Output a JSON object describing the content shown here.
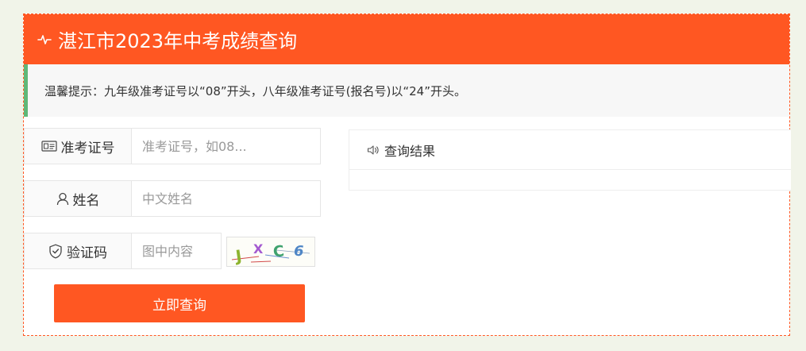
{
  "header": {
    "title": "湛江市2023年中考成绩查询",
    "icon": "pulse-icon"
  },
  "notice": {
    "text": "温馨提示：九年级准考证号以“08”开头，八年级准考证号(报名号)以“24”开头。"
  },
  "form": {
    "exam_id": {
      "label": "准考证号",
      "placeholder": "准考证号，如08...",
      "value": "",
      "icon": "id-card-icon"
    },
    "name": {
      "label": "姓名",
      "placeholder": "中文姓名",
      "value": "",
      "icon": "user-icon"
    },
    "captcha": {
      "label": "验证码",
      "placeholder": "图中内容",
      "value": "",
      "icon": "shield-check-icon",
      "image_text": "JXC6"
    },
    "submit_label": "立即查询"
  },
  "result": {
    "title": "查询结果",
    "icon": "speaker-icon"
  },
  "colors": {
    "accent": "#ff5722",
    "notice_bar": "#5fb878",
    "background": "#f1f4e9"
  }
}
